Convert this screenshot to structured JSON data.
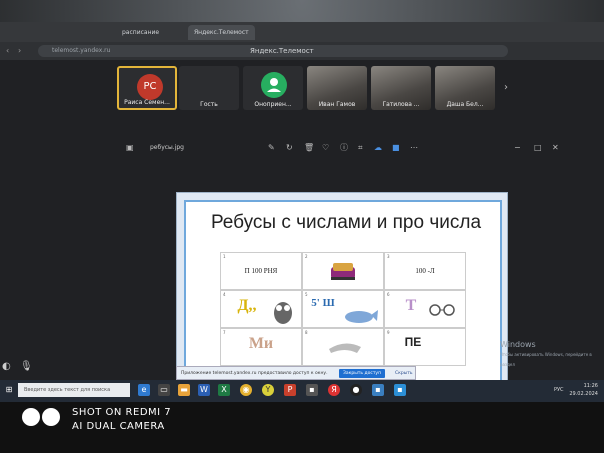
{
  "browser": {
    "tabs": [
      {
        "label": "расписание"
      },
      {
        "label": "Яндекс.Телемост"
      }
    ],
    "url": "telemost.yandex.ru",
    "page_title": "Яндекс.Телемост"
  },
  "participants": [
    {
      "initials": "РС",
      "name": "Раиса Семен...",
      "avatar_color": "#c0392b",
      "selected": true,
      "video": false
    },
    {
      "initials": "",
      "name": "Гость",
      "avatar_color": "",
      "selected": false,
      "video": false
    },
    {
      "initials": "",
      "name": "Оноприен...",
      "avatar_color": "#27ae60",
      "selected": false,
      "video": false
    },
    {
      "initials": "",
      "name": "Иван Гамов",
      "avatar_color": "",
      "selected": false,
      "video": true
    },
    {
      "initials": "",
      "name": "Гатилова ...",
      "avatar_color": "",
      "selected": false,
      "video": true
    },
    {
      "initials": "",
      "name": "Даша Бел...",
      "avatar_color": "",
      "selected": false,
      "video": true
    }
  ],
  "viewer": {
    "filename": "ребусы.jpg"
  },
  "slide": {
    "title": "Ребусы с числами и про числа",
    "cells": [
      {
        "num": "1",
        "text": "П 100 РНЯ",
        "big": false
      },
      {
        "num": "2",
        "text": "",
        "big": false
      },
      {
        "num": "3",
        "text": "100 -Л",
        "big": false
      },
      {
        "num": "4",
        "text": "Д,,",
        "big": true
      },
      {
        "num": "5",
        "text": "5' Ш",
        "big": true
      },
      {
        "num": "6",
        "text": "Т",
        "big": true
      },
      {
        "num": "7",
        "text": "Ми",
        "big": true
      },
      {
        "num": "8",
        "text": "",
        "big": false
      },
      {
        "num": "9",
        "text": "ПЕ",
        "big": true
      }
    ]
  },
  "notification": {
    "text": "Приложение telemost.yandex.ru предоставило доступ к окну.",
    "button": "Закрыть доступ",
    "close": "Скрыть"
  },
  "watermark": {
    "title": "Windows",
    "subtitle": "Чтобы активировать Windows, перейдите в раздел"
  },
  "taskbar": {
    "search_placeholder": "Введите здесь текст для поиска",
    "lang": "РУС",
    "time": "11:26",
    "date": "29.02.2024"
  },
  "camera_overlay": {
    "line1": "SHOT ON REDMI 7",
    "line2": "AI DUAL CAMERA"
  }
}
